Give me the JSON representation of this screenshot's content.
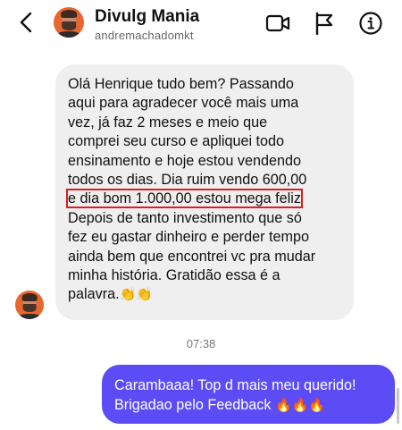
{
  "header": {
    "contact_name": "Divulg Mania",
    "username": "andremachadomkt"
  },
  "message_in": {
    "line_1": "Olá Henrique tudo bem? Passando",
    "line_2": "aqui para agradecer você mais uma",
    "line_3": "vez, já faz 2 meses e meio que",
    "line_4": "comprei seu curso e apliquei todo",
    "line_5": "ensinamento e hoje estou vendendo",
    "line_6": "todos os dias. Dia ruim vendo 600,00",
    "highlighted": "e dia bom 1.000,00 estou mega feliz",
    "line_8": "Depois de tanto investimento que só",
    "line_9": "fez eu gastar dinheiro e perder tempo",
    "line_10": "ainda bem que encontrei vc pra mudar",
    "line_11": "minha história. Gratidão essa é a",
    "line_12": "palavra.",
    "emoji": "👏👏"
  },
  "timestamp": "07:38",
  "message_out": {
    "line_1": "Carambaaa! Top d mais meu querido!",
    "line_2": "Brigadao pelo Feedback",
    "emoji": "🔥🔥🔥"
  },
  "colors": {
    "outgoing_bubble": "#5b4cf5",
    "incoming_bubble": "#efefef",
    "highlight_border": "#d81f26",
    "avatar_bg": "#e8672e"
  },
  "icons": [
    "back-icon",
    "video-call-icon",
    "flag-icon",
    "info-icon"
  ]
}
